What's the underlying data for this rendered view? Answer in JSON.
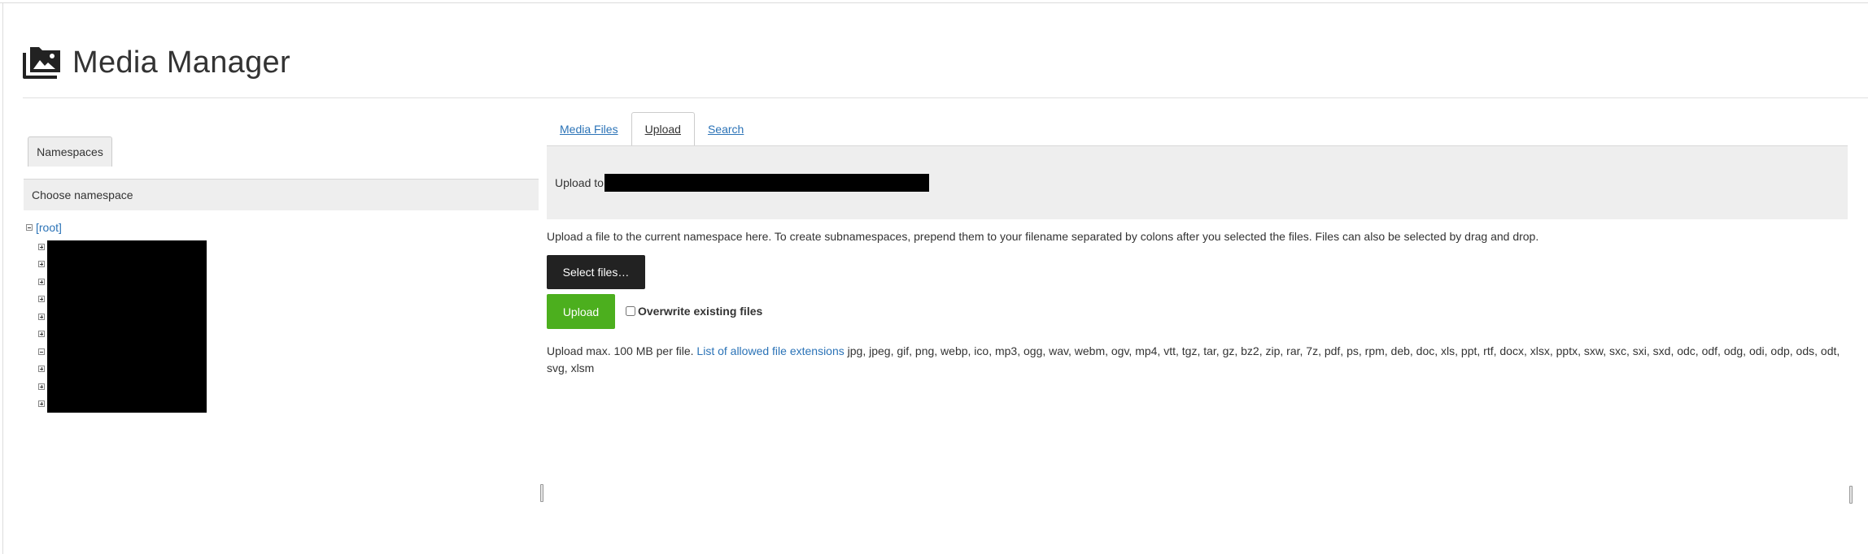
{
  "header": {
    "title": "Media Manager",
    "icon": "image-stack-icon"
  },
  "namespaces": {
    "tab_label": "Namespaces",
    "panel_title": "Choose namespace",
    "root_label": "[root]",
    "child_toggles": [
      "+",
      "+",
      "+",
      "+",
      "+",
      "+",
      "-",
      "+",
      "+",
      "+"
    ]
  },
  "tabs": [
    {
      "label": "Media Files",
      "active": false
    },
    {
      "label": "Upload",
      "active": true
    },
    {
      "label": "Search",
      "active": false
    }
  ],
  "upload": {
    "heading_prefix": "Upload to",
    "description": "Upload a file to the current namespace here. To create subnamespaces, prepend them to your filename separated by colons after you selected the files. Files can also be selected by drag and drop.",
    "select_files_label": "Select files…",
    "upload_label": "Upload",
    "overwrite_label": "Overwrite existing files",
    "max_text": "Upload max. 100 MB per file.",
    "extensions_link": "List of allowed file extensions",
    "extensions": "jpg, jpeg, gif, png, webp, ico, mp3, ogg, wav, webm, ogv, mp4, vtt, tgz, tar, gz, bz2, zip, rar, 7z, pdf, ps, rpm, deb, doc, xls, ppt, rtf, docx, xlsx, pptx, sxw, sxc, sxi, sxd, odc, odf, odg, odi, odp, ods, odt, svg, xlsm"
  },
  "colors": {
    "link": "#2b73b7",
    "upload_button": "#4caf1e",
    "select_button": "#222222",
    "panel_bg": "#eeeeee"
  }
}
